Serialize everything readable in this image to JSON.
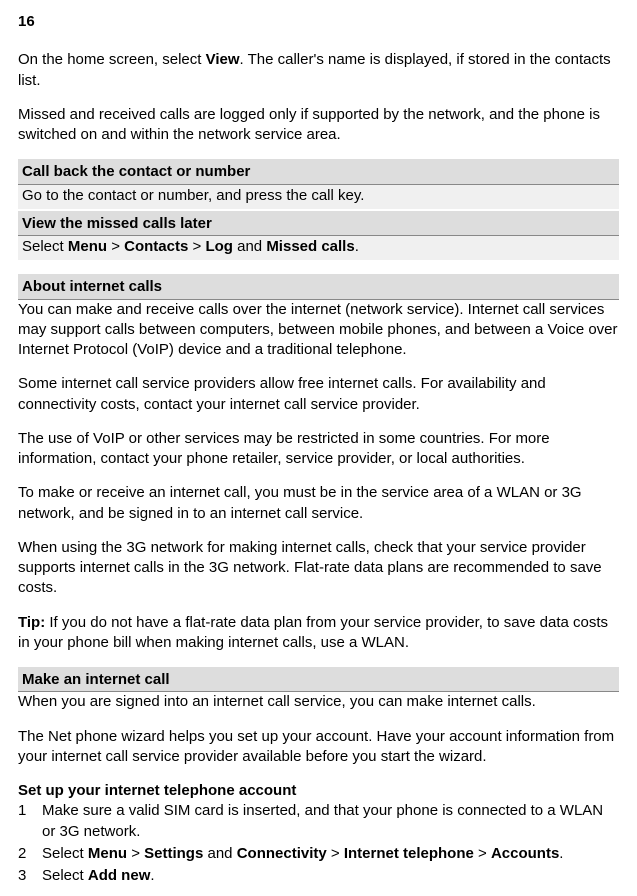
{
  "page_number": "16",
  "intro": {
    "pre": "On the home screen, select ",
    "view": "View",
    "post": ". The caller's name is displayed, if stored in the contacts list."
  },
  "missed_note": "Missed and received calls are logged only if supported by the network, and the phone is switched on and within the network service area.",
  "callback": {
    "header": "Call back the contact or number",
    "body": "Go to the contact or number, and press the call key."
  },
  "view_later": {
    "header": "View the missed calls later",
    "pre": "Select ",
    "menu": "Menu",
    "gt1": " > ",
    "contacts": "Contacts",
    "gt2": " > ",
    "log": "Log",
    "and": " and ",
    "missed": "Missed calls",
    "dot": "."
  },
  "about_internet": {
    "header": "About internet calls",
    "p1": "You can make and receive calls over the internet (network service). Internet call services may support calls between computers, between mobile phones, and between a Voice over Internet Protocol (VoIP) device and a traditional telephone.",
    "p2": "Some internet call service providers allow free internet calls. For availability and connectivity costs, contact your internet call service provider.",
    "p3": "The use of VoIP or other services may be restricted in some countries. For more information, contact your phone retailer, service provider, or local authorities.",
    "p4": "To make or receive an internet call, you must be in the service area of a WLAN or 3G network, and be signed in to an internet call service.",
    "p5": "When using the 3G network for making internet calls, check that your service provider supports internet calls in the 3G network. Flat-rate data plans are recommended to save costs.",
    "tip_label": "Tip:",
    "tip_body": " If you do not have a flat-rate data plan from your service provider, to save data costs in your phone bill when making internet calls, use a WLAN."
  },
  "make_call": {
    "header": "Make an internet call",
    "p1": "When you are signed into an internet call service, you can make internet calls.",
    "p2": "The Net phone wizard helps you set up your account. Have your account information from your internet call service provider available before you start the wizard.",
    "setup_header": "Set up your internet telephone account",
    "step1_num": "1",
    "step1": "Make sure a valid SIM card is inserted, and that your phone is connected to a WLAN or 3G network.",
    "step2_num": "2",
    "step2_pre": "Select ",
    "step2_menu": "Menu",
    "step2_gt1": " > ",
    "step2_settings": "Settings",
    "step2_and": " and ",
    "step2_conn": "Connectivity",
    "step2_gt2": " > ",
    "step2_itel": "Internet telephone",
    "step2_gt3": " > ",
    "step2_accounts": "Accounts",
    "step2_dot": ".",
    "step3_num": "3",
    "step3_pre": "Select ",
    "step3_add": "Add new",
    "step3_dot": "."
  }
}
